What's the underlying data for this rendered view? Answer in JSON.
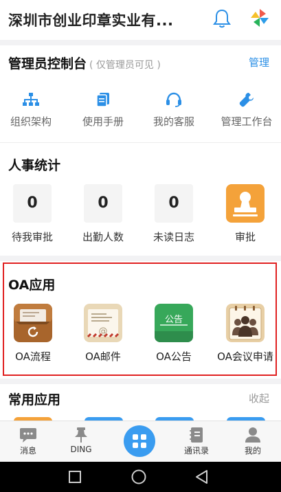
{
  "header": {
    "company_name": "深圳市创业印章实业有..."
  },
  "admin": {
    "title": "管理员控制台",
    "subtitle": "( 仅管理员可见 )",
    "manage_link": "管理",
    "items": [
      {
        "label": "组织架构",
        "icon": "org-chart-icon"
      },
      {
        "label": "使用手册",
        "icon": "manual-icon"
      },
      {
        "label": "我的客服",
        "icon": "headset-icon"
      },
      {
        "label": "管理工作台",
        "icon": "wrench-icon"
      }
    ]
  },
  "hr_stats": {
    "title": "人事统计",
    "items": [
      {
        "value": "0",
        "label": "待我审批"
      },
      {
        "value": "0",
        "label": "出勤人数"
      },
      {
        "value": "0",
        "label": "未读日志"
      }
    ],
    "approve_label": "审批"
  },
  "oa": {
    "title": "OA应用",
    "apps": [
      {
        "label": "OA流程",
        "icon": "oa-process-icon"
      },
      {
        "label": "OA邮件",
        "icon": "oa-mail-icon"
      },
      {
        "label": "OA公告",
        "icon": "oa-announcement-icon",
        "icon_text": "公告"
      },
      {
        "label": "OA会议申请",
        "icon": "oa-meeting-icon"
      }
    ]
  },
  "common_apps": {
    "title": "常用应用",
    "collapse_link": "收起"
  },
  "tabbar": {
    "tabs": [
      {
        "label": "消息",
        "icon": "message-icon"
      },
      {
        "label": "DING",
        "icon": "pin-icon"
      },
      {
        "label": "",
        "icon": "grid-icon"
      },
      {
        "label": "通讯录",
        "icon": "contacts-icon"
      },
      {
        "label": "我的",
        "icon": "person-icon"
      }
    ]
  },
  "colors": {
    "accent_blue": "#3a9cf0",
    "link_blue": "#2b8fe6",
    "approve_orange": "#f4a23a",
    "highlight_red": "#e02020",
    "muted_gray": "#999999"
  }
}
